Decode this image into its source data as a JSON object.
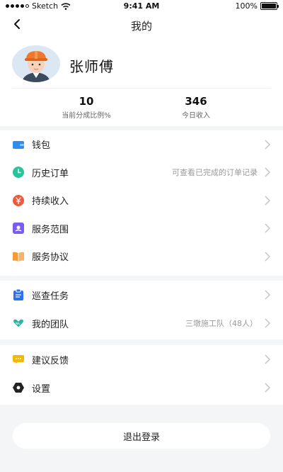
{
  "status_bar": {
    "carrier": "Sketch",
    "time": "9:41 AM",
    "battery": "100%"
  },
  "header": {
    "title": "我的"
  },
  "profile": {
    "name": "张师傅",
    "stats": [
      {
        "value": "10",
        "label": "当前分成比例%"
      },
      {
        "value": "346",
        "label": "今日收入"
      }
    ]
  },
  "menu": {
    "group1": [
      {
        "label": "钱包",
        "hint": "",
        "icon": "wallet-icon",
        "color": "#2e8ef0"
      },
      {
        "label": "历史订单",
        "hint": "可查看已完成的订单记录",
        "icon": "clock-icon",
        "color": "#29c49a"
      },
      {
        "label": "持续收入",
        "hint": "",
        "icon": "yuan-coin-icon",
        "color": "#ef5a3c"
      },
      {
        "label": "服务范围",
        "hint": "",
        "icon": "range-icon",
        "color": "#7a5cf0"
      },
      {
        "label": "服务协议",
        "hint": "",
        "icon": "book-icon",
        "color": "#f39a3b"
      }
    ],
    "group2": [
      {
        "label": "巡查任务",
        "hint": "",
        "icon": "clipboard-icon",
        "color": "#2e6ff0"
      },
      {
        "label": "我的团队",
        "hint": "三墩施工队（48人）",
        "icon": "handshake-icon",
        "color": "#27b5a6"
      }
    ],
    "group3": [
      {
        "label": "建议反馈",
        "hint": "",
        "icon": "feedback-icon",
        "color": "#f5b800"
      },
      {
        "label": "设置",
        "hint": "",
        "icon": "gear-icon",
        "color": "#222222"
      }
    ]
  },
  "logout": {
    "label": "退出登录"
  }
}
